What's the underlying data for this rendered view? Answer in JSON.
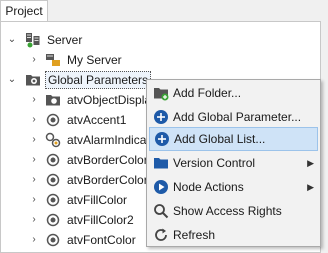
{
  "tab": {
    "label": "Project"
  },
  "tree": {
    "server": "Server",
    "my_server": "My Server",
    "global_parameters": "Global Parameters",
    "children": [
      "atvObjectDispla",
      "atvAccent1",
      "atvAlarmIndicat",
      "atvBorderColor",
      "atvBorderColor",
      "atvFillColor",
      "atvFillColor2",
      "atvFontColor"
    ]
  },
  "menu": {
    "add_folder": "Add Folder...",
    "add_global_parameter": "Add Global Parameter...",
    "add_global_list": "Add Global List...",
    "version_control": "Version Control",
    "node_actions": "Node Actions",
    "show_access_rights": "Show Access Rights",
    "refresh": "Refresh"
  },
  "colors": {
    "accent": "#1e5aa8",
    "highlight": "#cfe3f7",
    "folder": "#555555"
  }
}
